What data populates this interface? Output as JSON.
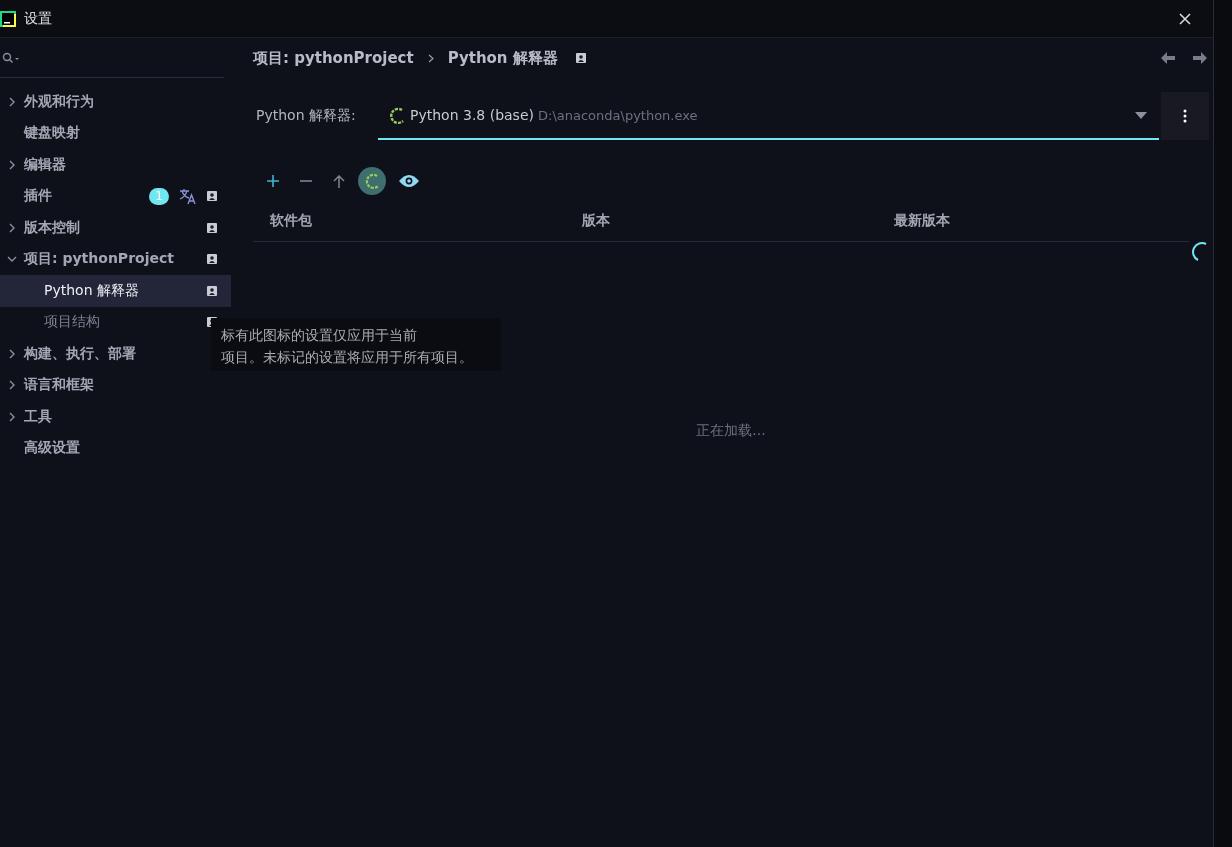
{
  "window": {
    "title": "设置"
  },
  "sidebar": {
    "items": [
      {
        "label": "外观和行为",
        "expanded": false
      },
      {
        "label": "键盘映射"
      },
      {
        "label": "编辑器",
        "expanded": false
      },
      {
        "label": "插件",
        "badge": "1",
        "translate": true,
        "project_scoped": true
      },
      {
        "label": "版本控制",
        "expanded": false,
        "project_scoped": true
      },
      {
        "label": "项目: pythonProject",
        "expanded": true,
        "project_scoped": true,
        "children": [
          {
            "label": "Python 解释器",
            "selected": true,
            "project_scoped": true
          },
          {
            "label": "项目结构",
            "selected": false,
            "project_scoped": true
          }
        ]
      },
      {
        "label": "构建、执行、部署",
        "expanded": false
      },
      {
        "label": "语言和框架",
        "expanded": false
      },
      {
        "label": "工具",
        "expanded": false
      },
      {
        "label": "高级设置"
      }
    ]
  },
  "tooltip": {
    "lines": [
      "标有此图标的设置仅应用于当前",
      "项目。未标记的设置将应用于所有项目。"
    ]
  },
  "breadcrumb": {
    "items": [
      "项目: pythonProject",
      "Python 解释器"
    ],
    "project_scoped": true
  },
  "interpreter": {
    "label": "Python 解释器:",
    "value": "Python 3.8 (base)",
    "path": "D:\\anaconda\\python.exe"
  },
  "table": {
    "columns": [
      "软件包",
      "版本",
      "最新版本"
    ],
    "loading": "正在加载..."
  }
}
